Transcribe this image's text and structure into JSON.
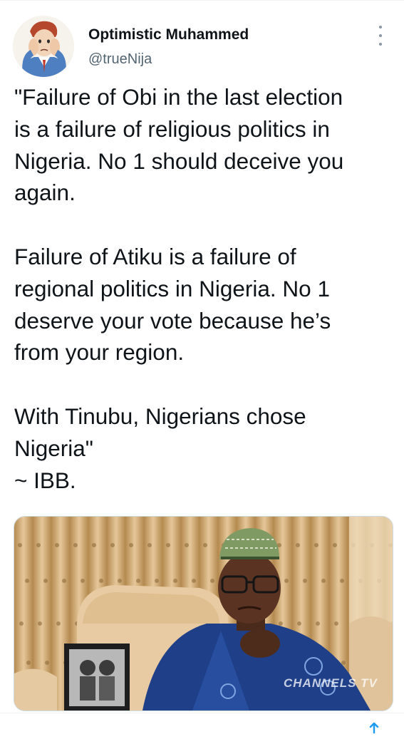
{
  "tweet": {
    "author_name": "Optimistic Muhammed",
    "author_handle": "@trueNija",
    "lines": [
      "\"Failure of Obi in the last election",
      "is a failure of religious politics in",
      "Nigeria. No 1 should deceive you",
      "again.",
      "",
      "Failure of Atiku is a failure of",
      "regional politics in Nigeria. No 1",
      "deserve your vote because he’s",
      "from your region.",
      "",
      "With Tinubu, Nigerians chose",
      "Nigeria\"",
      " ~ IBB."
    ],
    "media_watermark": "CHANNELS TV"
  },
  "colors": {
    "text": "#0f1419",
    "secondary": "#536471",
    "accent": "#1d9bf0"
  },
  "icons": {
    "more": "more-options-icon",
    "avatar": "cartoon-avatar",
    "bottom": "share-icon"
  }
}
